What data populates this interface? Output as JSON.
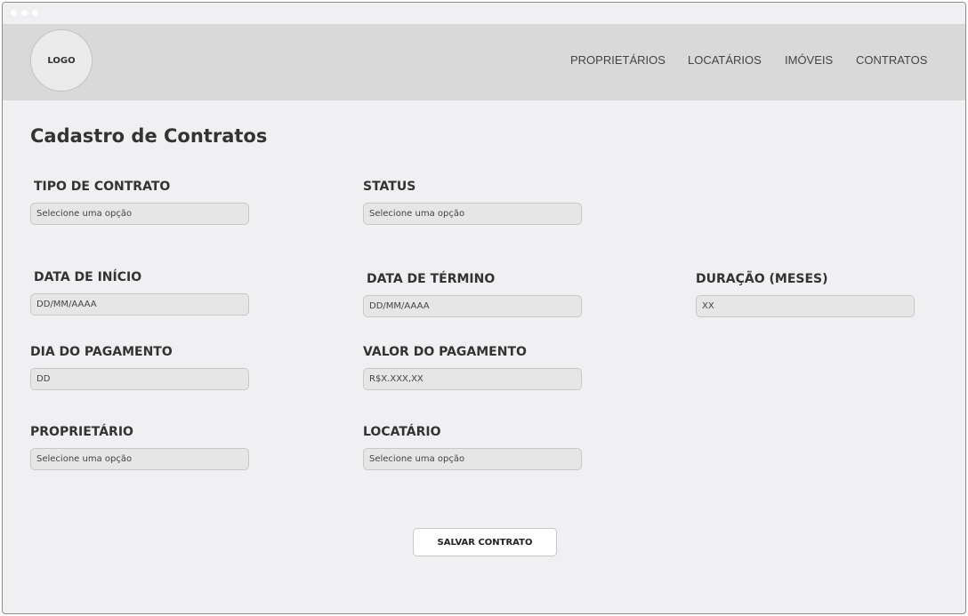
{
  "header": {
    "logo_text": "LOGO",
    "nav": [
      "PROPRIETÁRIOS",
      "LOCATÁRIOS",
      "IMÓVEIS",
      "CONTRATOS"
    ]
  },
  "page_title": "Cadastro de Contratos",
  "form": {
    "tipo_contrato": {
      "label": "TIPO DE CONTRATO",
      "placeholder": "Selecione uma opção"
    },
    "status": {
      "label": "STATUS",
      "placeholder": "Selecione uma opção"
    },
    "data_inicio": {
      "label": "DATA DE INÍCIO",
      "placeholder": "DD/MM/AAAA"
    },
    "data_termino": {
      "label": "DATA DE TÉRMINO",
      "placeholder": "DD/MM/AAAA"
    },
    "duracao": {
      "label": "DURAÇÃO (MESES)",
      "placeholder": "XX"
    },
    "dia_pagamento": {
      "label": "DIA DO PAGAMENTO",
      "placeholder": "DD"
    },
    "valor_pagamento": {
      "label": "VALOR DO PAGAMENTO",
      "placeholder": "R$X.XXX,XX"
    },
    "proprietario": {
      "label": "PROPRIETÁRIO",
      "placeholder": "Selecione uma opção"
    },
    "locatario": {
      "label": "LOCATÁRIO",
      "placeholder": "Selecione uma opção"
    }
  },
  "save_button": "SALVAR CONTRATO"
}
